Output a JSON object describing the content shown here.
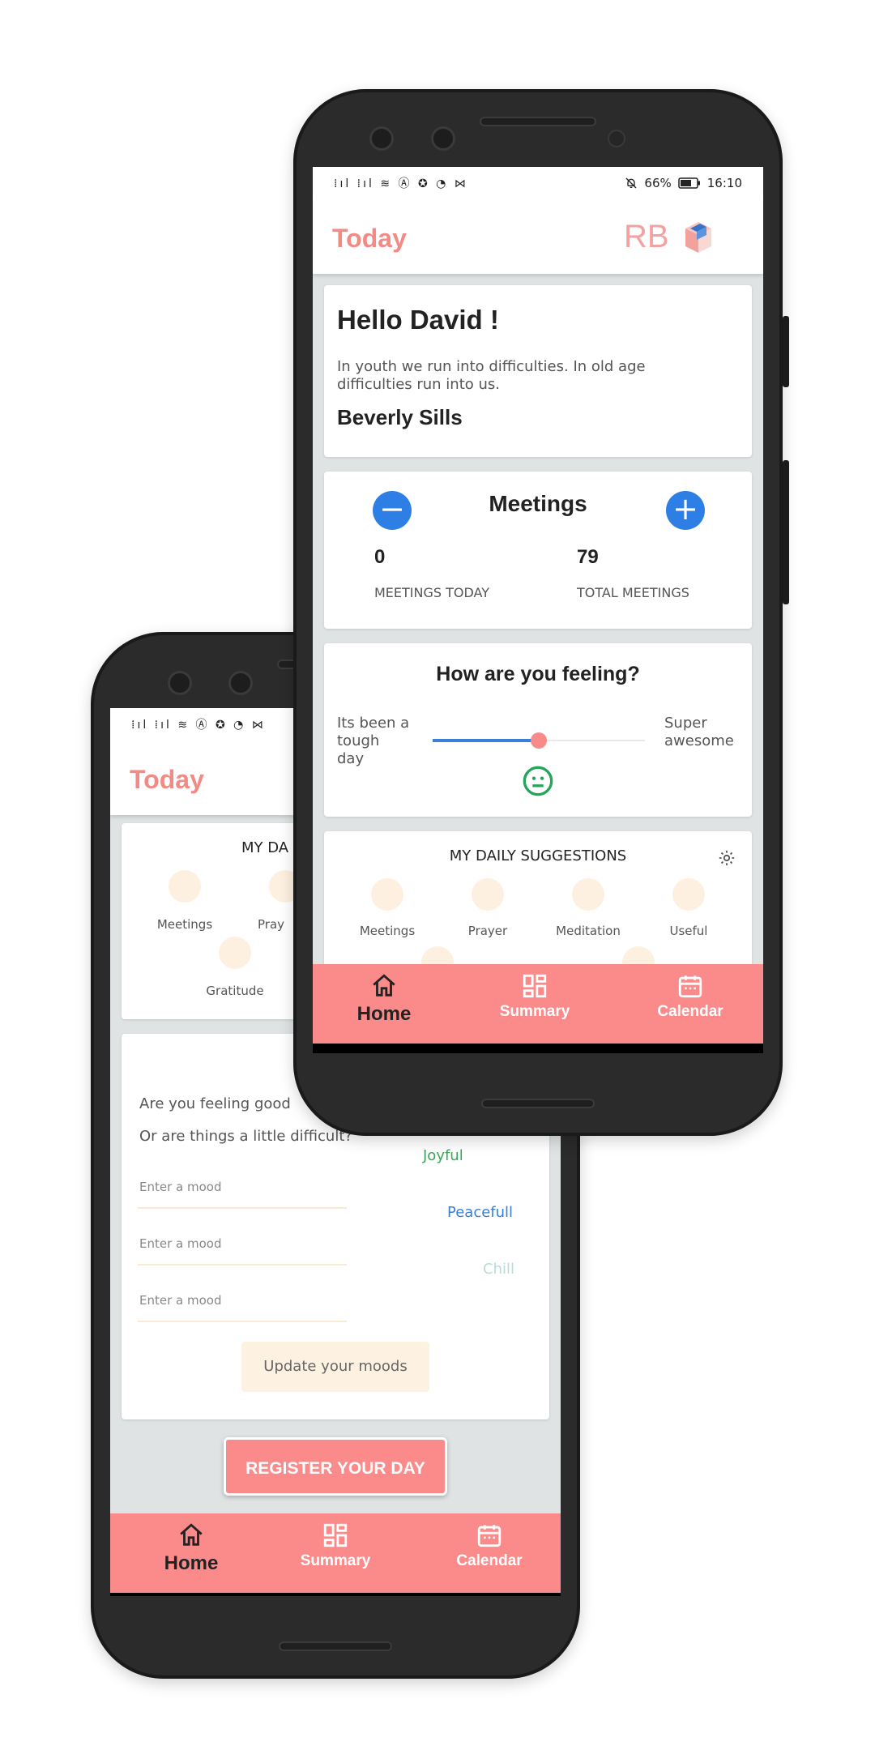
{
  "status_bar": {
    "left_icons": "⁞ıl ⁞ıl ≋ Ⓐ ✪ ◔ ⋈",
    "battery": "66%",
    "time": "16:10",
    "bell_icon": "bell-off-icon"
  },
  "front": {
    "app_title": "Today",
    "logo_text": "RB",
    "greeting": "Hello David !",
    "quote": "In youth we run into difficulties. In old age difficulties run into us.",
    "quote_author": "Beverly Sills",
    "meetings": {
      "title": "Meetings",
      "minus": "−",
      "plus": "+",
      "today_value": "0",
      "today_label": "MEETINGS TODAY",
      "total_value": "79",
      "total_label": "TOTAL MEETINGS"
    },
    "feeling": {
      "title": "How are you feeling?",
      "left_label": "Its been a tough day",
      "right_label": "Super awesome",
      "slider_fraction": 0.5
    },
    "suggestions": {
      "title": "MY DAILY SUGGESTIONS",
      "items": [
        "Meetings",
        "Prayer",
        "Meditation",
        "Useful"
      ]
    },
    "nav": [
      {
        "label": "Home",
        "icon": "home-icon"
      },
      {
        "label": "Summary",
        "icon": "dashboard-icon"
      },
      {
        "label": "Calendar",
        "icon": "calendar-icon"
      }
    ]
  },
  "back": {
    "app_title": "Today",
    "suggestions_title": "MY DA",
    "suggestion_items": [
      "Meetings",
      "Pray",
      "Gratitude"
    ],
    "mood_q1": "Are you feeling good",
    "mood_q2": "Or are things a little difficult?",
    "mood_placeholder": "Enter a mood",
    "moods": [
      {
        "label": "Joyful",
        "color": "#3aa757"
      },
      {
        "label": "Peacefull",
        "color": "#3a7fd5"
      },
      {
        "label": "Chill",
        "color": "#b8dcd8"
      }
    ],
    "update_button": "Update your moods",
    "register_button": "REGISTER YOUR DAY",
    "nav": [
      {
        "label": "Home",
        "icon": "home-icon"
      },
      {
        "label": "Summary",
        "icon": "dashboard-icon"
      },
      {
        "label": "Calendar",
        "icon": "calendar-icon"
      }
    ]
  },
  "colors": {
    "accent": "#f28a86",
    "navbar": "#fb8a8a",
    "blue": "#2d7fe6",
    "smile": "#26a65b"
  }
}
